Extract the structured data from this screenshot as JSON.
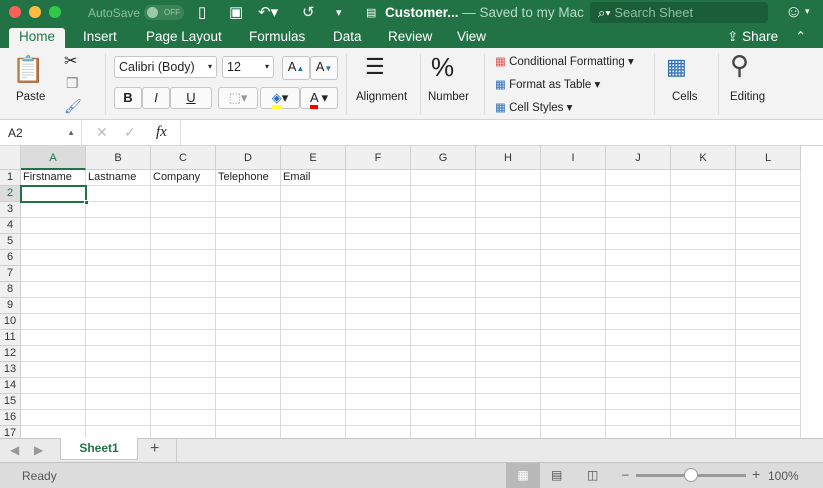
{
  "titlebar": {
    "autosave": "AutoSave",
    "toggle": "OFF",
    "doc_title": "Customer...",
    "saved": " — Saved to my Mac",
    "search_placeholder": "Search Sheet"
  },
  "tabs": [
    "Home",
    "Insert",
    "Page Layout",
    "Formulas",
    "Data",
    "Review",
    "View"
  ],
  "share": "Share",
  "ribbon": {
    "paste": "Paste",
    "font": "Calibri (Body)",
    "size": "12",
    "bold": "B",
    "italic": "I",
    "underline": "U",
    "font_color": "A",
    "grow": "A",
    "shrink": "A",
    "alignment": "Alignment",
    "number": "Number",
    "cond": "Conditional Formatting",
    "table": "Format as Table",
    "styles": "Cell Styles",
    "cells": "Cells",
    "editing": "Editing"
  },
  "formula": {
    "name_box": "A2",
    "fx": "fx",
    "value": ""
  },
  "columns": [
    "A",
    "B",
    "C",
    "D",
    "E",
    "F",
    "G",
    "H",
    "I",
    "J",
    "K",
    "L"
  ],
  "rows": [
    "1",
    "2",
    "3",
    "4",
    "5",
    "6",
    "7",
    "8",
    "9",
    "10",
    "11",
    "12",
    "13",
    "14",
    "15",
    "16",
    "17"
  ],
  "cells": {
    "1": [
      "Firstname",
      "Lastname",
      "Company",
      "Telephone",
      "Email"
    ]
  },
  "sheets": [
    "Sheet1"
  ],
  "status": {
    "ready": "Ready",
    "zoom": "100%",
    "zoom_level": 0.5
  },
  "colors": {
    "brand": "#217346"
  }
}
